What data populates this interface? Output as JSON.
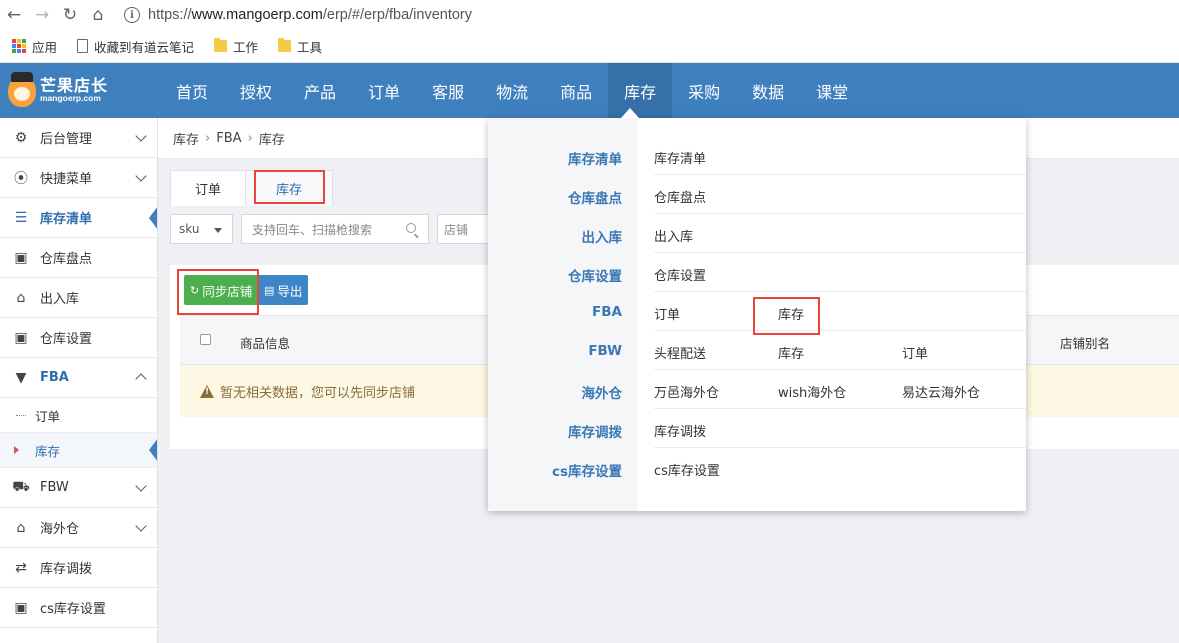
{
  "browser": {
    "url_scheme": "https://",
    "url_host": "www.mangoerp.com",
    "url_path": "/erp/#/erp/fba/inventory",
    "bookmarks": [
      {
        "label": "应用",
        "icon": "apps-icon"
      },
      {
        "label": "收藏到有道云笔记",
        "icon": "page-icon"
      },
      {
        "label": "工作",
        "icon": "folder-icon"
      },
      {
        "label": "工具",
        "icon": "folder-icon"
      }
    ]
  },
  "logo": {
    "title": "芒果店长",
    "subtitle": "mangoerp.com"
  },
  "topnav": {
    "items": [
      "首页",
      "授权",
      "产品",
      "订单",
      "客服",
      "物流",
      "商品",
      "库存",
      "采购",
      "数据",
      "课堂"
    ],
    "active": "库存"
  },
  "sidebar": {
    "items": [
      {
        "label": "后台管理",
        "icon": "gear-icon",
        "chevron": "down"
      },
      {
        "label": "快捷菜单",
        "icon": "compass-icon",
        "chevron": "down"
      },
      {
        "label": "库存清单",
        "icon": "list-icon",
        "active": true
      },
      {
        "label": "仓库盘点",
        "icon": "box-icon"
      },
      {
        "label": "出入库",
        "icon": "warehouse-icon"
      },
      {
        "label": "仓库设置",
        "icon": "box-settings-icon"
      },
      {
        "label": "FBA",
        "icon": "fba-icon",
        "chevron": "up"
      }
    ],
    "fba_sub": [
      {
        "label": "订单"
      },
      {
        "label": "库存",
        "active": true
      }
    ],
    "items_after": [
      {
        "label": "FBW",
        "icon": "truck-icon",
        "chevron": "down"
      },
      {
        "label": "海外仓",
        "icon": "house-icon",
        "chevron": "down"
      },
      {
        "label": "库存调拨",
        "icon": "transfer-icon"
      },
      {
        "label": "cs库存设置",
        "icon": "cs-box-icon"
      }
    ]
  },
  "breadcrumb": [
    "库存",
    "FBA",
    "库存"
  ],
  "tabs": [
    "订单",
    "库存"
  ],
  "filters": {
    "select_value": "sku",
    "search_placeholder": "支持回车、扫描枪搜索",
    "shop_placeholder": "店铺"
  },
  "actions": {
    "sync_label": "同步店铺",
    "export_label": "导出"
  },
  "table": {
    "headers": [
      "商品信息",
      "店铺别名"
    ],
    "empty_message": "暂无相关数据，您可以先同步店铺"
  },
  "dropdown": {
    "rows": [
      {
        "category": "库存清单",
        "links": [
          "库存清单"
        ]
      },
      {
        "category": "仓库盘点",
        "links": [
          "仓库盘点"
        ]
      },
      {
        "category": "出入库",
        "links": [
          "出入库"
        ]
      },
      {
        "category": "仓库设置",
        "links": [
          "仓库设置"
        ]
      },
      {
        "category": "FBA",
        "links": [
          "订单",
          "库存"
        ]
      },
      {
        "category": "FBW",
        "links": [
          "头程配送",
          "库存",
          "订单"
        ]
      },
      {
        "category": "海外仓",
        "links": [
          "万邑海外仓",
          "wish海外仓",
          "易达云海外仓"
        ]
      },
      {
        "category": "库存调拨",
        "links": [
          "库存调拨"
        ]
      },
      {
        "category": "cs库存设置",
        "links": [
          "cs库存设置"
        ]
      }
    ]
  },
  "colors": {
    "nav_blue": "#3e7fbd",
    "nav_active": "#3770a8",
    "link_blue": "#3b78b5",
    "sync_green": "#4cae4c",
    "export_blue": "#3c85c7",
    "highlight_red": "#e8453c",
    "warning_bg": "#fcf8e3"
  }
}
